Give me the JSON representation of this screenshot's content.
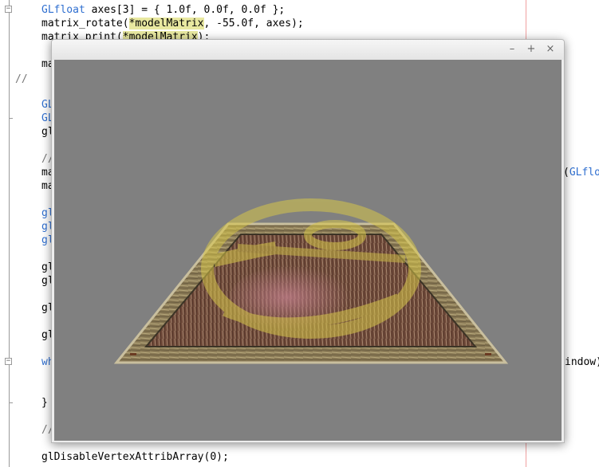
{
  "editor": {
    "lines": {
      "l1": {
        "kw": "GLfloat",
        "rest": " axes[3] = { 1.0f, 0.0f, 0.0f };"
      },
      "l2": {
        "pre": "matrix_rotate(",
        "hl": "*modelMatrix",
        "post": ", -55.0f, axes);"
      },
      "l3": {
        "pre": "matrix_print(",
        "hl": "*modelMatrix",
        "post": ");"
      },
      "l4": "ma",
      "comment_marker": "//",
      "l5": "GL",
      "l6": "GL",
      "l7": "gl",
      "l8": "//",
      "l9": "ma",
      "l10": "ma",
      "l11": "gl",
      "l12": "gl",
      "l13": "gl",
      "l14": "gl",
      "l15": "gl",
      "l16": "gl",
      "l17": "gl",
      "l18": "wh",
      "l19": "}",
      "l20": "//",
      "l21": "glDisableVertexAttribArray(0);",
      "right_paren": "(",
      "right_kw": "GLflo",
      "right_window": "indow)"
    },
    "fold_plus": "+",
    "fold_minus": "−"
  },
  "window": {
    "minimize_label": "–",
    "maximize_label": "+",
    "close_label": "×",
    "viewport_bg": "#808080"
  }
}
